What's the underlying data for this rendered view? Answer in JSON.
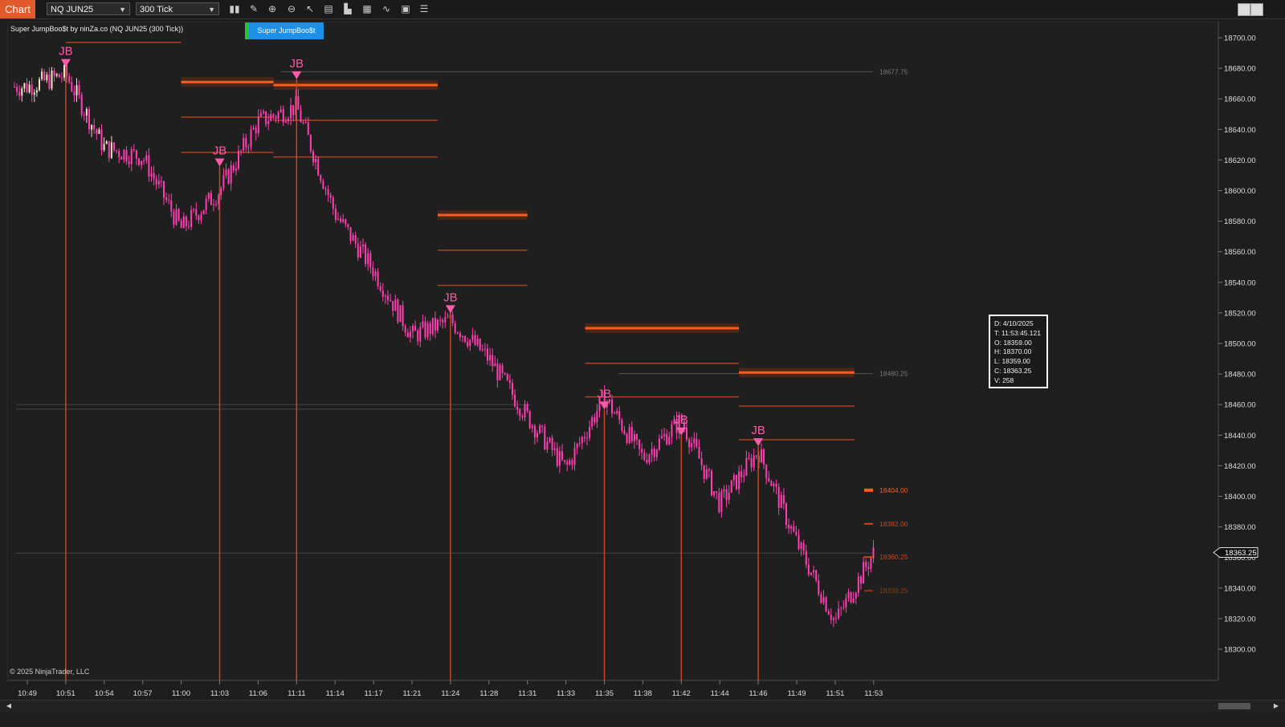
{
  "toolbar": {
    "chart_tab": "Chart",
    "instrument": "NQ JUN25",
    "interval": "300 Tick",
    "icons": [
      "bar-type-icon",
      "drawing-tool-icon",
      "zoom-in-icon",
      "zoom-out-icon",
      "pointer-icon",
      "data-box-icon",
      "chart-trader-icon",
      "properties-icon",
      "indicators-icon",
      "strategies-icon",
      "object-list-icon"
    ]
  },
  "chart": {
    "title": "Super JumpBoo$t by ninZa.co (NQ JUN25 (300 Tick))",
    "indicator_button": "Super JumpBoo$t",
    "copyright": "© 2025 NinjaTrader, LLC",
    "signal_label": "JB",
    "colors": {
      "background": "#1f1f1f",
      "candle_down": "#ff3fb1",
      "candle_up": "#f3e0c8",
      "signal": "#ff5aa8",
      "level_strong": "#ff5a1f",
      "level_line": "#c9471f",
      "ref_line": "#5a5a5a"
    }
  },
  "databox": {
    "date": "D:  4/10/2025",
    "time": "T:  11:53:45.121",
    "open": "O:  18359.00",
    "high": "H:  18370.00",
    "low": "L:  18359.00",
    "close": "C:  18363.25",
    "volume": "V:  258"
  },
  "chart_data": {
    "type": "candlestick",
    "instrument": "NQ JUN25",
    "interval": "300 Tick",
    "y_axis_ticks": [
      "18700.00",
      "18680.00",
      "18660.00",
      "18640.00",
      "18620.00",
      "18600.00",
      "18580.00",
      "18560.00",
      "18540.00",
      "18520.00",
      "18500.00",
      "18480.00",
      "18460.00",
      "18440.00",
      "18420.00",
      "18400.00",
      "18380.00",
      "18360.00",
      "18340.00",
      "18320.00",
      "18300.00"
    ],
    "ylim": [
      18290,
      18705
    ],
    "x_axis_ticks": [
      "10:49",
      "10:51",
      "10:54",
      "10:57",
      "11:00",
      "11:03",
      "11:06",
      "11:11",
      "11:14",
      "11:17",
      "11:21",
      "11:24",
      "11:28",
      "11:31",
      "11:33",
      "11:35",
      "11:38",
      "11:42",
      "11:44",
      "11:46",
      "11:49",
      "11:51",
      "11:53"
    ],
    "last_price": "18363.25",
    "price_trend": [
      {
        "t": "10:49",
        "p": 18668
      },
      {
        "t": "10:51",
        "p": 18676
      },
      {
        "t": "10:54",
        "p": 18628
      },
      {
        "t": "10:57",
        "p": 18622
      },
      {
        "t": "11:00",
        "p": 18575
      },
      {
        "t": "11:03",
        "p": 18600
      },
      {
        "t": "11:06",
        "p": 18645
      },
      {
        "t": "11:11",
        "p": 18655
      },
      {
        "t": "11:14",
        "p": 18585
      },
      {
        "t": "11:17",
        "p": 18548
      },
      {
        "t": "11:21",
        "p": 18505
      },
      {
        "t": "11:24",
        "p": 18515
      },
      {
        "t": "11:28",
        "p": 18490
      },
      {
        "t": "11:31",
        "p": 18452
      },
      {
        "t": "11:33",
        "p": 18418
      },
      {
        "t": "11:35",
        "p": 18465
      },
      {
        "t": "11:38",
        "p": 18425
      },
      {
        "t": "11:42",
        "p": 18450
      },
      {
        "t": "11:44",
        "p": 18395
      },
      {
        "t": "11:46",
        "p": 18430
      },
      {
        "t": "11:49",
        "p": 18370
      },
      {
        "t": "11:51",
        "p": 18318
      },
      {
        "t": "11:53",
        "p": 18363
      }
    ],
    "signals": [
      {
        "label": "JB",
        "time": "10:51",
        "price": 18686
      },
      {
        "label": "JB",
        "time": "11:03",
        "price": 18621
      },
      {
        "label": "JB",
        "time": "11:11",
        "price": 18678
      },
      {
        "label": "JB",
        "time": "11:24",
        "price": 18525
      },
      {
        "label": "JB",
        "time": "11:35",
        "price": 18462
      },
      {
        "label": "JB",
        "time": "11:42",
        "price": 18445
      },
      {
        "label": "JB",
        "time": "11:46",
        "price": 18438
      }
    ],
    "level_lines": [
      {
        "from": "10:51",
        "to": "11:00",
        "price": 18697,
        "style": "line"
      },
      {
        "from": "11:00",
        "to": "11:08",
        "price": 18671,
        "style": "strong"
      },
      {
        "from": "11:08",
        "to": "11:23",
        "price": 18669,
        "style": "strong"
      },
      {
        "from": "11:00",
        "to": "11:08",
        "price": 18648,
        "style": "line"
      },
      {
        "from": "11:08",
        "to": "11:23",
        "price": 18646,
        "style": "line"
      },
      {
        "from": "11:00",
        "to": "11:08",
        "price": 18625,
        "style": "line"
      },
      {
        "from": "11:08",
        "to": "11:23",
        "price": 18622,
        "style": "line"
      },
      {
        "from": "11:23",
        "to": "11:31",
        "price": 18584,
        "style": "strong"
      },
      {
        "from": "11:23",
        "to": "11:31",
        "price": 18561,
        "style": "line"
      },
      {
        "from": "11:23",
        "to": "11:31",
        "price": 18538,
        "style": "line"
      },
      {
        "from": "11:34",
        "to": "11:45",
        "price": 18510,
        "style": "strong"
      },
      {
        "from": "11:34",
        "to": "11:45",
        "price": 18487,
        "style": "line"
      },
      {
        "from": "11:45",
        "to": "11:52",
        "price": 18481,
        "style": "strong"
      },
      {
        "from": "11:34",
        "to": "11:45",
        "price": 18465,
        "style": "line"
      },
      {
        "from": "11:45",
        "to": "11:52",
        "price": 18459,
        "style": "line"
      },
      {
        "from": "11:45",
        "to": "11:52",
        "price": 18437,
        "style": "line"
      }
    ],
    "right_labels": [
      {
        "text": "18677.75",
        "price": 18677.75,
        "color": "#777777"
      },
      {
        "text": "18480.25",
        "price": 18480.25,
        "color": "#777777"
      },
      {
        "text": "18404.00",
        "price": 18404.0,
        "color": "#ff5a1f"
      },
      {
        "text": "18382.00",
        "price": 18382.0,
        "color": "#c9471f"
      },
      {
        "text": "18360.25",
        "price": 18360.25,
        "color": "#c9471f"
      },
      {
        "text": "18338.25",
        "price": 18338.25,
        "color": "#8a3a1a"
      }
    ]
  }
}
